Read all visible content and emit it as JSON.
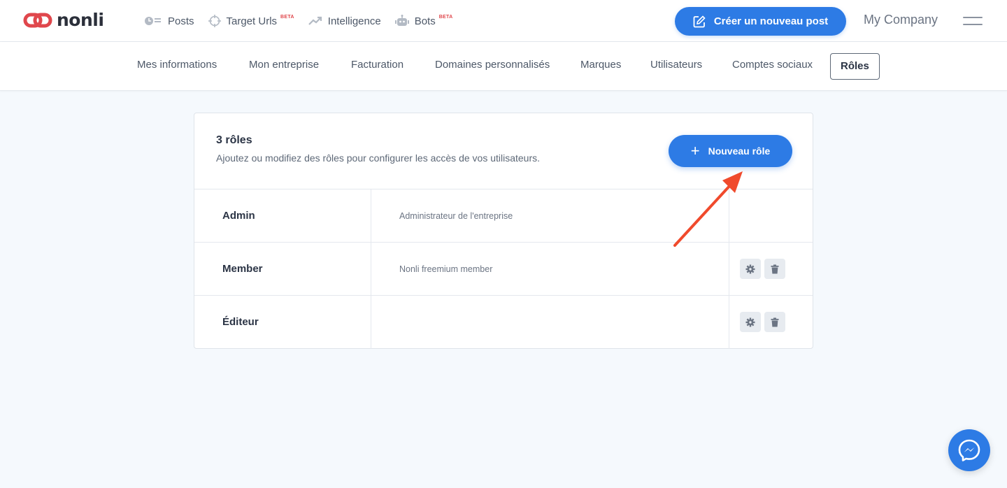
{
  "brand": {
    "name": "nonli"
  },
  "nav": {
    "items": [
      {
        "label": "Posts",
        "icon": "posts-icon",
        "beta": ""
      },
      {
        "label": "Target Urls",
        "icon": "target-icon",
        "beta": "BETA"
      },
      {
        "label": "Intelligence",
        "icon": "trend-icon",
        "beta": ""
      },
      {
        "label": "Bots",
        "icon": "bot-icon",
        "beta": "BETA"
      }
    ]
  },
  "header": {
    "create_label": "Créer un nouveau post",
    "company": "My Company"
  },
  "subnav": {
    "tabs": [
      "Mes informations",
      "Mon entreprise",
      "Facturation",
      "Domaines personnalisés",
      "Marques",
      "Utilisateurs",
      "Comptes sociaux",
      "Rôles"
    ],
    "active": "Rôles"
  },
  "roles_card": {
    "title": "3 rôles",
    "subtitle": "Ajoutez ou modifiez des rôles pour configurer les accès de vos utilisateurs.",
    "new_role_label": "Nouveau rôle",
    "roles": [
      {
        "name": "Admin",
        "description": "Administrateur de l'entreprise",
        "editable": false
      },
      {
        "name": "Member",
        "description": "Nonli freemium member",
        "editable": true
      },
      {
        "name": "Éditeur",
        "description": "",
        "editable": true
      }
    ]
  },
  "colors": {
    "accent": "#2d7be5",
    "brand_red": "#e0474c",
    "annotation_arrow": "#f04a2c",
    "background": "#f5f9fd"
  }
}
